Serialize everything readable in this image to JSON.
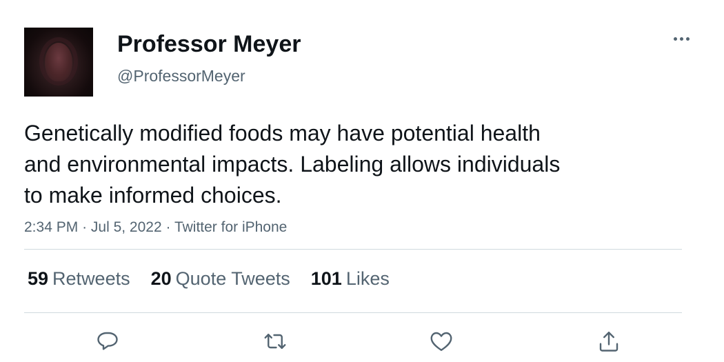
{
  "author": {
    "display_name": "Professor Meyer",
    "handle": "@ProfessorMeyer"
  },
  "tweet": {
    "text_lines": [
      "Genetically modified foods may have potential health",
      "and environmental impacts. Labeling allows individuals",
      "to make informed choices."
    ],
    "time": "2:34 PM",
    "date": "Jul 5, 2022",
    "source": "Twitter for iPhone",
    "separator": "·"
  },
  "stats": {
    "retweets": {
      "count": "59",
      "label": "Retweets"
    },
    "quote_tweets": {
      "count": "20",
      "label": "Quote Tweets"
    },
    "likes": {
      "count": "101",
      "label": "Likes"
    }
  },
  "actions": [
    "reply-icon",
    "retweet-icon",
    "like-icon",
    "share-icon"
  ],
  "colors": {
    "text_primary": "#0f1419",
    "text_secondary": "#536471",
    "divider": "#cfd9de"
  }
}
